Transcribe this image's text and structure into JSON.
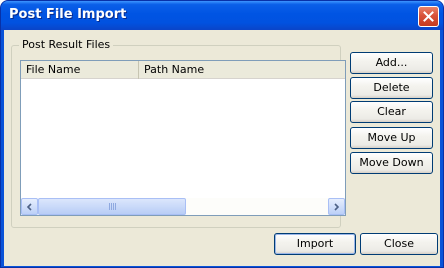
{
  "window": {
    "title": "Post File Import"
  },
  "group": {
    "label": "Post Result Files"
  },
  "list": {
    "columns": [
      "File Name",
      "Path Name"
    ],
    "rows": []
  },
  "side_buttons": {
    "add": "Add...",
    "delete": "Delete",
    "clear": "Clear",
    "move_up": "Move Up",
    "move_down": "Move Down"
  },
  "footer": {
    "import": "Import",
    "close": "Close"
  },
  "colors": {
    "titlebar": "#0054e3",
    "dialog_bg": "#ece9d8",
    "close_button": "#d9523a"
  }
}
